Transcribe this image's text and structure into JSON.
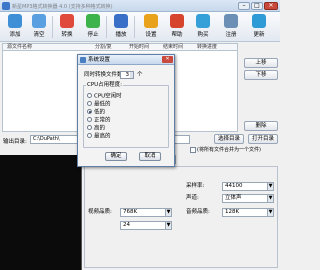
{
  "window": {
    "title": "新星MP3格式转换器 4.0 (支持多种格式转换)"
  },
  "toolbar": {
    "items": [
      {
        "label": "添加",
        "icon": "add-file-icon",
        "color": "#3f8fd6"
      },
      {
        "label": "清空",
        "icon": "clear-list-icon",
        "color": "#5aa0e0"
      },
      {
        "label": "转换",
        "icon": "convert-icon",
        "color": "#e04a3a"
      },
      {
        "label": "停止",
        "icon": "stop-icon",
        "color": "#3db34b"
      },
      {
        "label": "播放",
        "icon": "play-icon",
        "color": "#3a6fc7"
      },
      {
        "label": "设置",
        "icon": "settings-icon",
        "color": "#e8a21c"
      },
      {
        "label": "帮助",
        "icon": "help-icon",
        "color": "#d7442e"
      },
      {
        "label": "购买",
        "icon": "buy-cart-icon",
        "color": "#35a0d8"
      },
      {
        "label": "注册",
        "icon": "register-icon",
        "color": "#6c8fb5"
      },
      {
        "label": "更新",
        "icon": "update-icon",
        "color": "#2e9ad6"
      }
    ]
  },
  "file_list": {
    "columns": [
      "源文件名称",
      "分割/复",
      "开始时间",
      "结束时间",
      "转换进度"
    ]
  },
  "side_buttons": {
    "up": "上移",
    "down": "下移",
    "delete": "删除"
  },
  "output": {
    "label": "输出目录:",
    "path": "C:\\DuPath\\",
    "choose_label": "选择目录",
    "open_label": "打开目录",
    "merge_option": "(将所有文件合并为一个文件)"
  },
  "params": {
    "sample_rate_label": "采样率:",
    "sample_rate_value": "44100",
    "channels_label": "声道:",
    "channels_value": "立体声",
    "video_quality_label": "视频品质:",
    "video_quality_value": "768K",
    "audio_quality_label": "音频品质:",
    "audio_quality_value": "128K",
    "codec_value": "24"
  },
  "dialog": {
    "title": "系统设置",
    "concurrent_label": "同时转换文件数:",
    "concurrent_value": "3",
    "concurrent_unit": "个",
    "cpu_group_title": "CPU占用程度:",
    "cpu_options": [
      {
        "label": "CPU空闲时",
        "selected": false
      },
      {
        "label": "最低的",
        "selected": false
      },
      {
        "label": "低的",
        "selected": true
      },
      {
        "label": "正常的",
        "selected": false
      },
      {
        "label": "高的",
        "selected": false
      },
      {
        "label": "最高的",
        "selected": false
      }
    ],
    "ok_label": "确定",
    "cancel_label": "取消"
  }
}
